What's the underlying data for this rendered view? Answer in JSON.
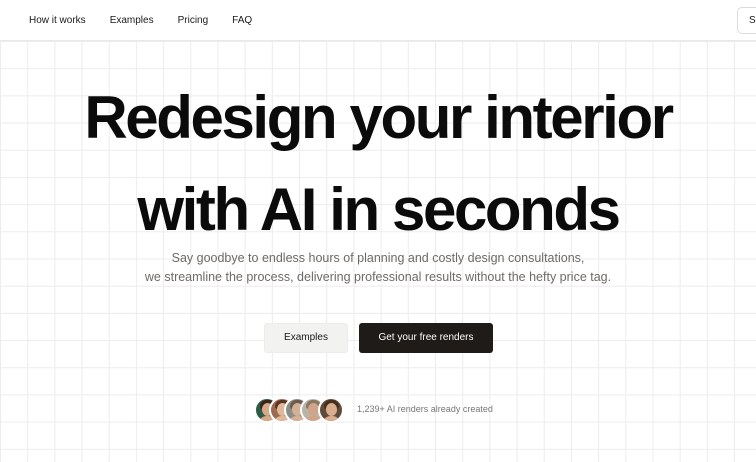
{
  "nav": {
    "links": [
      "How it works",
      "Examples",
      "Pricing",
      "FAQ"
    ],
    "signin_label": "Si"
  },
  "hero": {
    "title_line1": "Redesign your interior",
    "title_line2": "with AI in seconds",
    "subtitle_line1": "Say goodbye to endless hours of planning and costly design consultations,",
    "subtitle_line2": "we streamline the process, delivering professional results without the hefty price tag."
  },
  "cta": {
    "secondary_label": "Examples",
    "primary_label": "Get your free renders"
  },
  "social_proof": {
    "text": "1,239+ AI renders already created",
    "avatars": [
      {
        "bg": "#2f5a47",
        "skin": "#d8a989",
        "hair": "#3b2519"
      },
      {
        "bg": "#9c6b52",
        "skin": "#e2b89a",
        "hair": "#5a3522"
      },
      {
        "bg": "#8d8d88",
        "skin": "#d6b096",
        "hair": "#6c5a4a"
      },
      {
        "bg": "#b9b3a8",
        "skin": "#cfa488",
        "hair": "#8a7761"
      },
      {
        "bg": "#5f4b3c",
        "skin": "#d9ad8e",
        "hair": "#4a2f1f"
      }
    ]
  },
  "colors": {
    "primary_button": "#1e1b19",
    "secondary_button": "#f2f2f1",
    "grid_line": "#ececec",
    "subtitle_text": "#6e6a65"
  }
}
